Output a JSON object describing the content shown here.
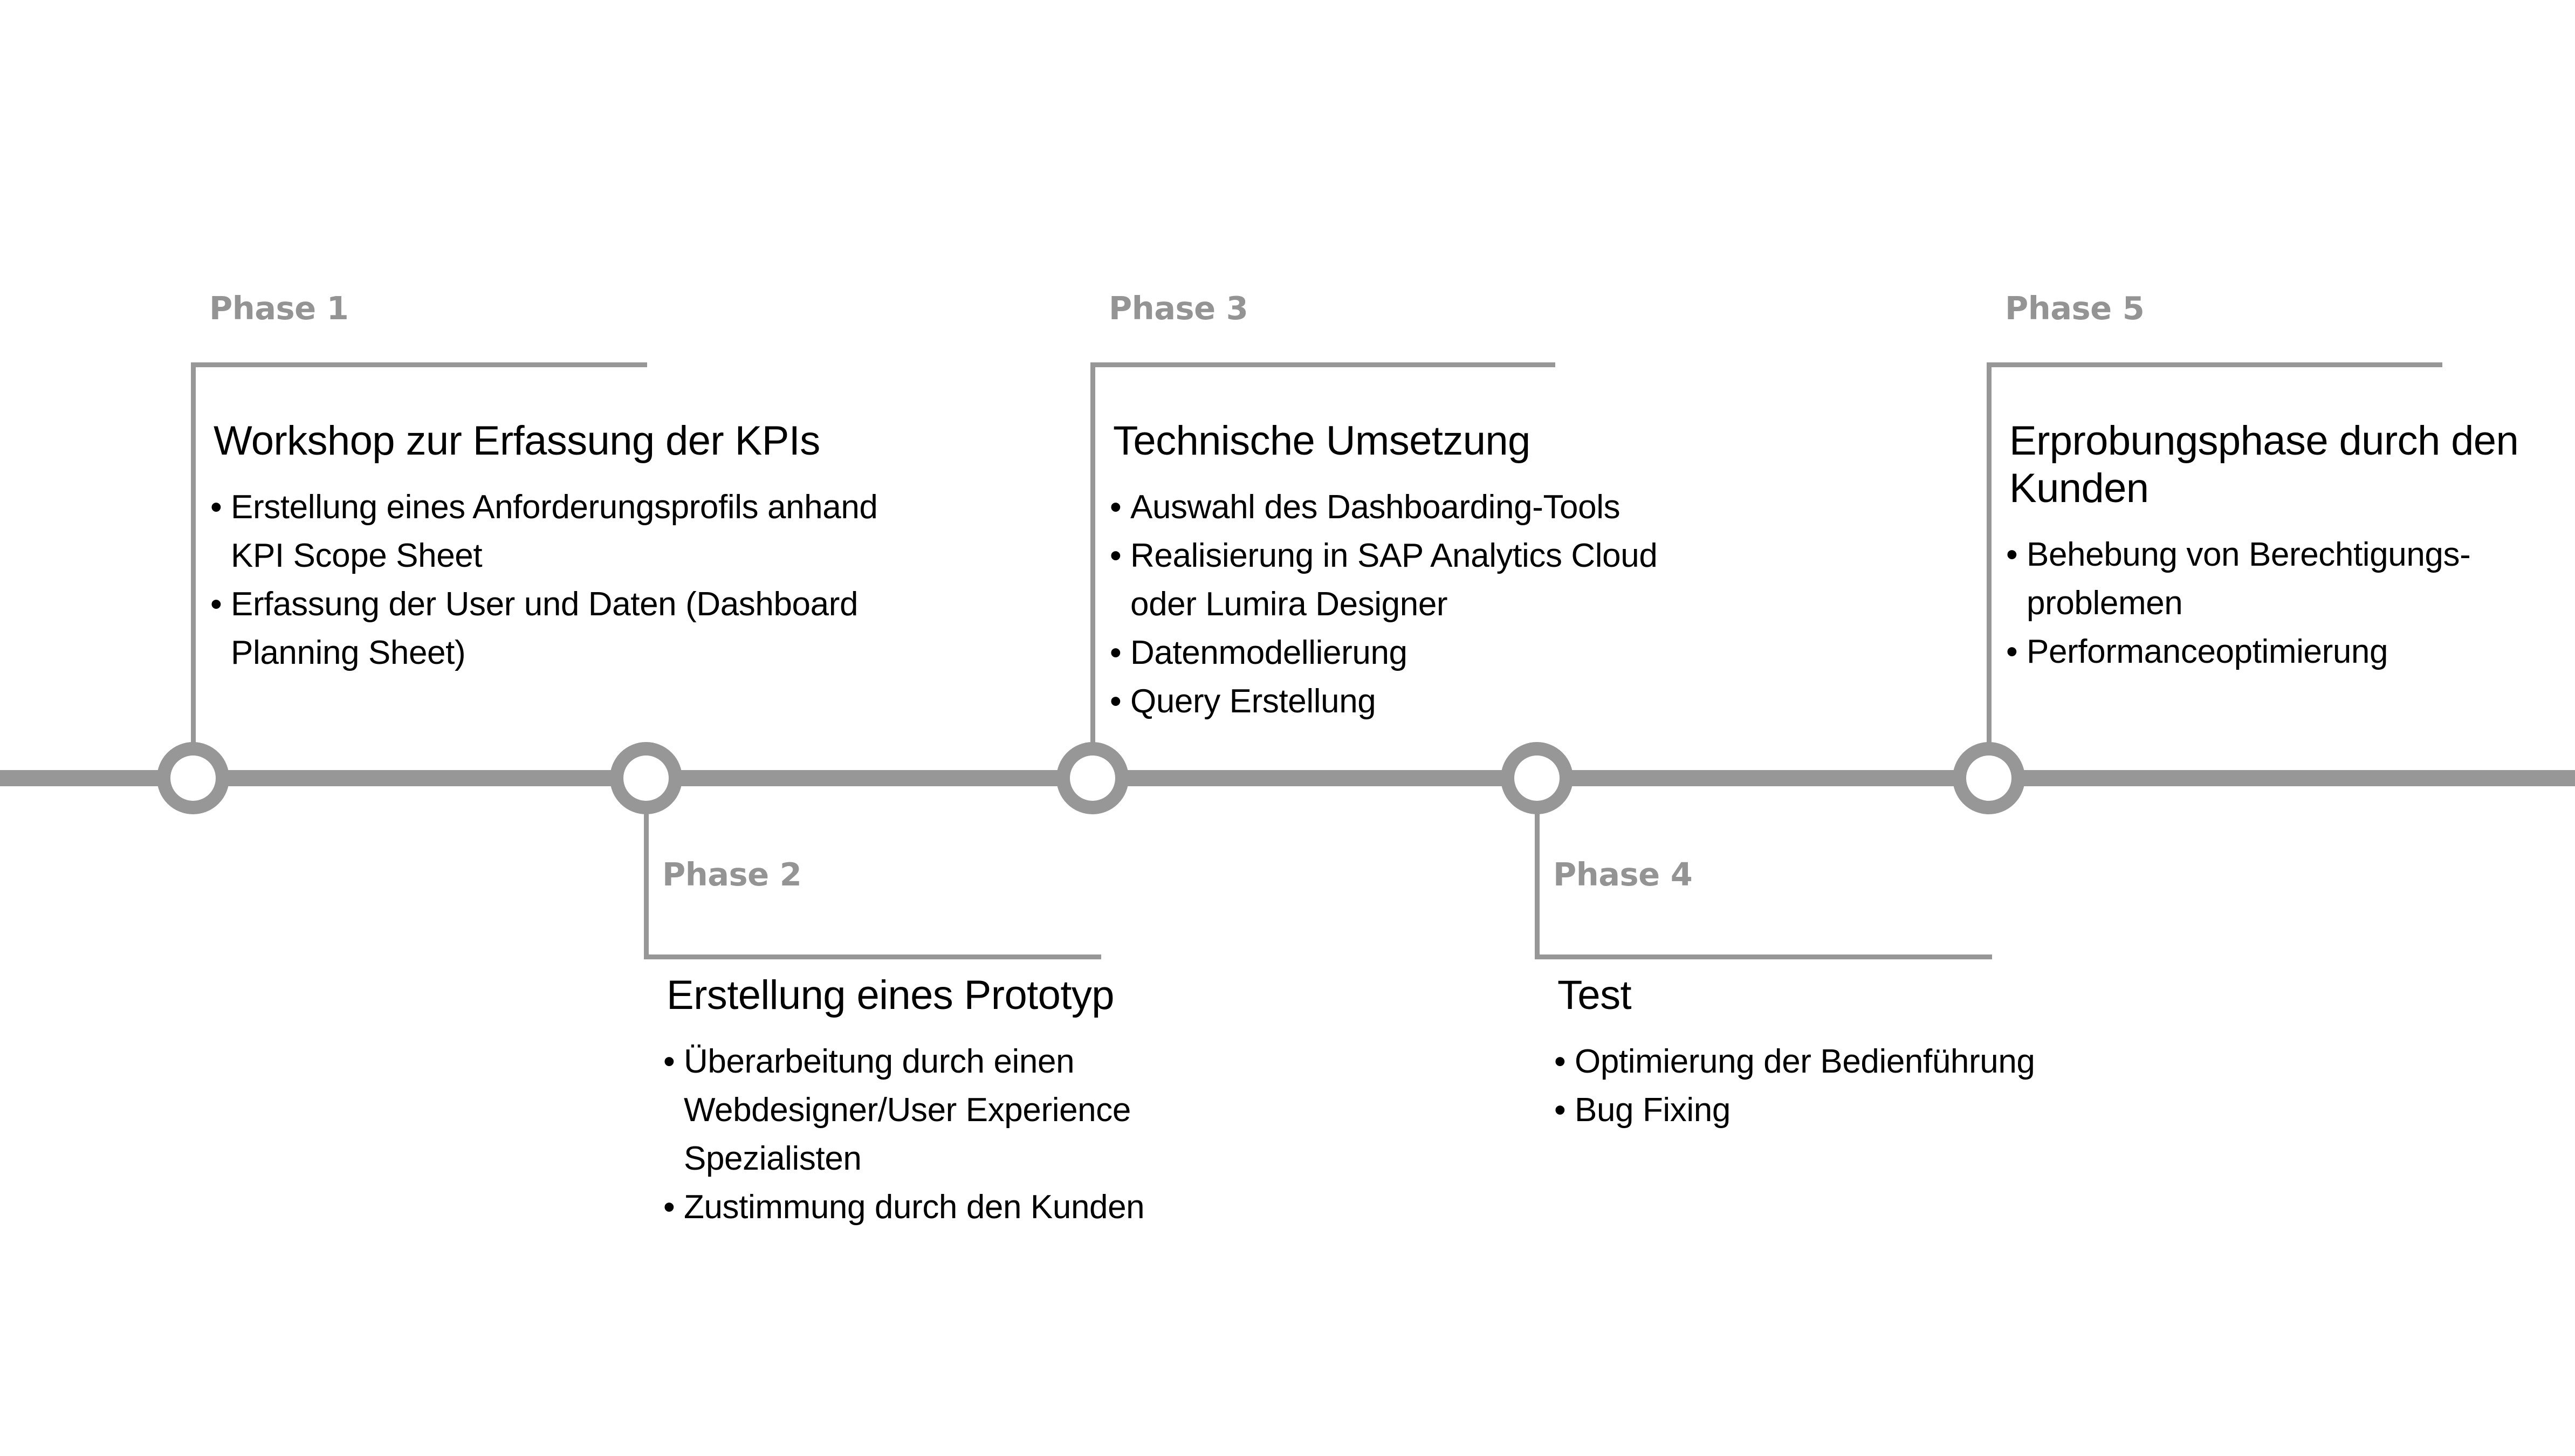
{
  "theme": {
    "axis_color": "#979797",
    "label_color": "#949494",
    "text_color": "#000000",
    "background": "#ffffff"
  },
  "diagram": {
    "type": "timeline",
    "orientation": "horizontal",
    "phase_count": 5
  },
  "phases": [
    {
      "label": "Phase 1",
      "title": "Workshop zur Erfassung der KPIs",
      "position": "above",
      "bullets": [
        "Erstellung eines Anforderungsprofils anhand KPI Scope Sheet",
        "Erfassung der User und Daten (Dashboard Planning Sheet)"
      ]
    },
    {
      "label": "Phase 2",
      "title": "Erstellung eines Prototyp",
      "position": "below",
      "bullets": [
        "Überarbeitung durch einen Webdesigner/User Experience Spezialisten",
        "Zustimmung durch den Kunden"
      ]
    },
    {
      "label": "Phase 3",
      "title": "Technische Umsetzung",
      "position": "above",
      "bullets": [
        "Auswahl des Dashboarding-Tools",
        "Realisierung in SAP Analytics Cloud oder Lumira Designer",
        "Datenmodellierung",
        "Query Erstellung"
      ]
    },
    {
      "label": "Phase 4",
      "title": "Test",
      "position": "below",
      "bullets": [
        "Optimierung der Bedienführung",
        "Bug Fixing"
      ]
    },
    {
      "label": "Phase 5",
      "title": "Erprobungsphase durch den Kunden",
      "position": "above",
      "bullets": [
        "Behebung von Berechtigungs-problemen",
        "Performanceoptimierung"
      ]
    }
  ]
}
